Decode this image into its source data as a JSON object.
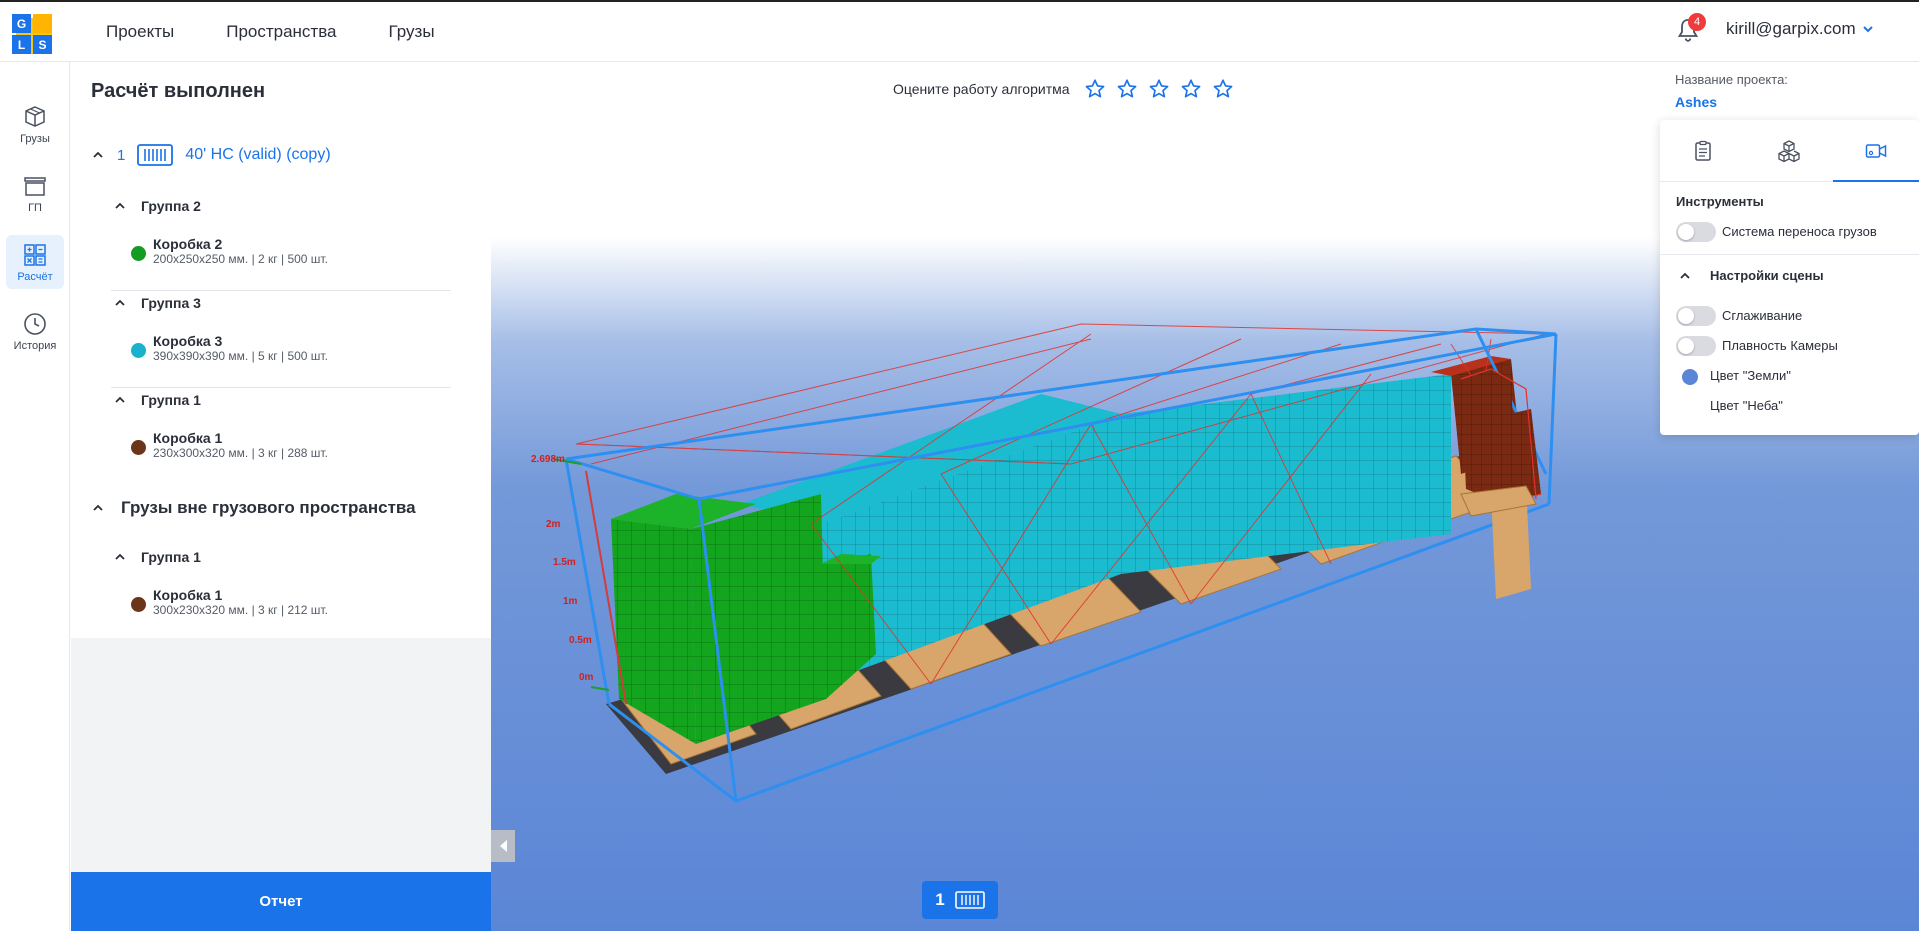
{
  "header": {
    "logo_letters": [
      "G",
      "L",
      "S"
    ],
    "nav": [
      "Проекты",
      "Пространства",
      "Грузы"
    ],
    "notifications_count": "4",
    "user_email": "kirill@garpix.com"
  },
  "sidebar": {
    "items": [
      {
        "label": "Грузы",
        "icon": "boxes-icon",
        "active": false
      },
      {
        "label": "ГП",
        "icon": "container-icon",
        "active": false
      },
      {
        "label": "Расчёт",
        "icon": "calculator-icon",
        "active": true
      },
      {
        "label": "История",
        "icon": "clock-icon",
        "active": false
      }
    ]
  },
  "calc": {
    "title": "Расчёт выполнен",
    "container": {
      "number": "1",
      "name": "40' HC (valid) (copy)"
    },
    "groups": [
      {
        "name": "Группа 2",
        "item": {
          "name": "Коробка 2",
          "meta": "200x250x250 мм. | 2 кг | 500 шт.",
          "color": "#139b22"
        }
      },
      {
        "name": "Группа 3",
        "item": {
          "name": "Коробка 3",
          "meta": "390x390x390 мм. | 5 кг | 500 шт.",
          "color": "#1bb0cc"
        }
      },
      {
        "name": "Группа 1",
        "item": {
          "name": "Коробка 1",
          "meta": "230x300x320 мм. | 3 кг | 288 шт.",
          "color": "#6b3519"
        }
      }
    ],
    "outside": {
      "title": "Грузы вне грузового пространства",
      "groups": [
        {
          "name": "Группа 1",
          "item": {
            "name": "Коробка 1",
            "meta": "300x230x320 мм. | 3 кг | 212 шт.",
            "color": "#6b3519"
          }
        }
      ]
    },
    "report_button": "Отчет"
  },
  "rating": {
    "label": "Оцените работу алгоритма",
    "stars": 5
  },
  "scene": {
    "ruler_labels": [
      "2.698m",
      "2m",
      "1.5m",
      "1m",
      "0.5m",
      "0m"
    ],
    "container_tab_number": "1"
  },
  "right_panel": {
    "project_label": "Название проекта:",
    "project_name": "Ashes",
    "tools_title": "Инструменты",
    "cargo_transfer": "Система переноса грузов",
    "scene_settings": "Настройки сцены",
    "smoothing": "Сглаживание",
    "camera_smooth": "Плавность Камеры",
    "ground_color_label": "Цвет \"Земли\"",
    "ground_color": "#5b86d8",
    "sky_color_label": "Цвет \"Неба\""
  },
  "colors": {
    "accent": "#1a73e8",
    "badge": "#ef3b3b"
  }
}
